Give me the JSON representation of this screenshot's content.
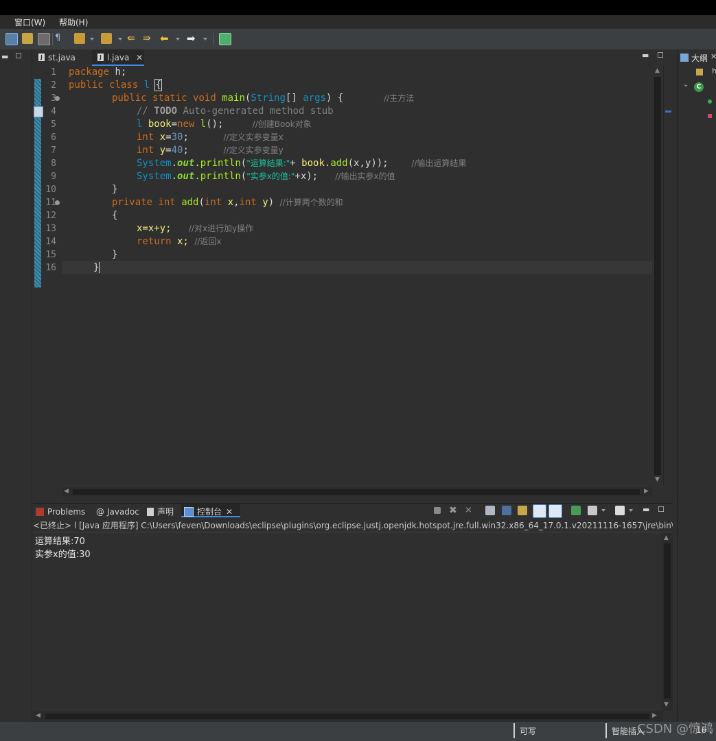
{
  "menu": {
    "window": "窗口(W)",
    "help": "帮助(H)"
  },
  "editor_tabs": [
    {
      "label": "st.java"
    },
    {
      "label": "l.java",
      "active": true
    }
  ],
  "right_panel": {
    "outline_title": "大纲",
    "item": "h"
  },
  "code": {
    "line_numbers": [
      "1",
      "2",
      "3",
      "4",
      "5",
      "6",
      "7",
      "8",
      "9",
      "10",
      "11",
      "12",
      "13",
      "14",
      "15",
      "16"
    ],
    "l1": {
      "kw": "package",
      "rest": " h;"
    },
    "l2": {
      "kw1": "public",
      "kw2": "class",
      "name": "l",
      "brace": "{"
    },
    "l3": {
      "kw1": "public",
      "kw2": "static",
      "kw3": "void",
      "fn": "main",
      "paren": "(",
      "type": "String",
      "arr": "[] ",
      "arg": "args",
      "close": ") {",
      "comment": "//主方法"
    },
    "l4": {
      "slashes": "// ",
      "todo": "TODO",
      "rest": " Auto-generated method stub"
    },
    "l5": {
      "cls": "l",
      "var": "book",
      "eq": "=",
      "kw": "new",
      "ctor": "l",
      "paren": "();",
      "comment": "//创建Book对象"
    },
    "l6": {
      "kw": "int",
      "var": "x",
      "eq": "=",
      "num": "30",
      "semi": ";",
      "comment": "//定义实参变量x"
    },
    "l7": {
      "kw": "int",
      "var": "y",
      "eq": "=",
      "num": "40",
      "semi": ";",
      "comment": "//定义实参变量y"
    },
    "l8": {
      "sys": "System",
      "dot1": ".",
      "out": "out",
      "dot2": ".",
      "fn": "println",
      "open": "(",
      "str": "\"运算结果:\"",
      "plus": "+ ",
      "obj": "book",
      "dot3": ".",
      "call": "add",
      "args": "(x,y));",
      "comment": "//输出运算结果"
    },
    "l9": {
      "sys": "System",
      "dot1": ".",
      "out": "out",
      "dot2": ".",
      "fn": "println",
      "open": "(",
      "str": "\"实参x的值:\"",
      "rest": "+x);",
      "comment": "//输出实参x的值"
    },
    "l10": {
      "brace": "}"
    },
    "l11": {
      "kw1": "private",
      "kw2": "int",
      "fn": "add",
      "open": "(",
      "kw3": "int",
      "p1": "x",
      "comma": ",",
      "kw4": "int",
      "p2": "y",
      "close": ")",
      "comment": "//计算两个数的和"
    },
    "l12": {
      "brace": "{"
    },
    "l13": {
      "code": "x=x+y;",
      "comment": "//对x进行加y操作"
    },
    "l14": {
      "kw": "return",
      "rest": " x;",
      "comment": "//返回x"
    },
    "l15": {
      "brace": "}"
    },
    "l16": {
      "brace": "}"
    }
  },
  "console_tabs": [
    {
      "label": "Problems"
    },
    {
      "label": "Javadoc"
    },
    {
      "label": "声明"
    },
    {
      "label": "控制台",
      "active": true
    }
  ],
  "console": {
    "header": "<已终止> l [Java 应用程序] C:\\Users\\feven\\Downloads\\eclipse\\plugins\\org.eclipse.justj.openjdk.hotspot.jre.full.win32.x86_64_17.0.1.v20211116-1657\\jre\\bin\\javaw.",
    "output": [
      "运算结果:70",
      "实参x的值:30"
    ]
  },
  "status": {
    "writable": "可写",
    "insert_mode": "智能插入",
    "position": "16 :"
  },
  "watermark": "CSDN @惊鸿",
  "colors": {
    "keyword": "#cc6c1d",
    "type": "#1290c3",
    "method": "#a7ec21",
    "variable": "#f3ec79",
    "string": "#17c6a3",
    "comment": "#808080",
    "accent": "#3a8ee6"
  }
}
